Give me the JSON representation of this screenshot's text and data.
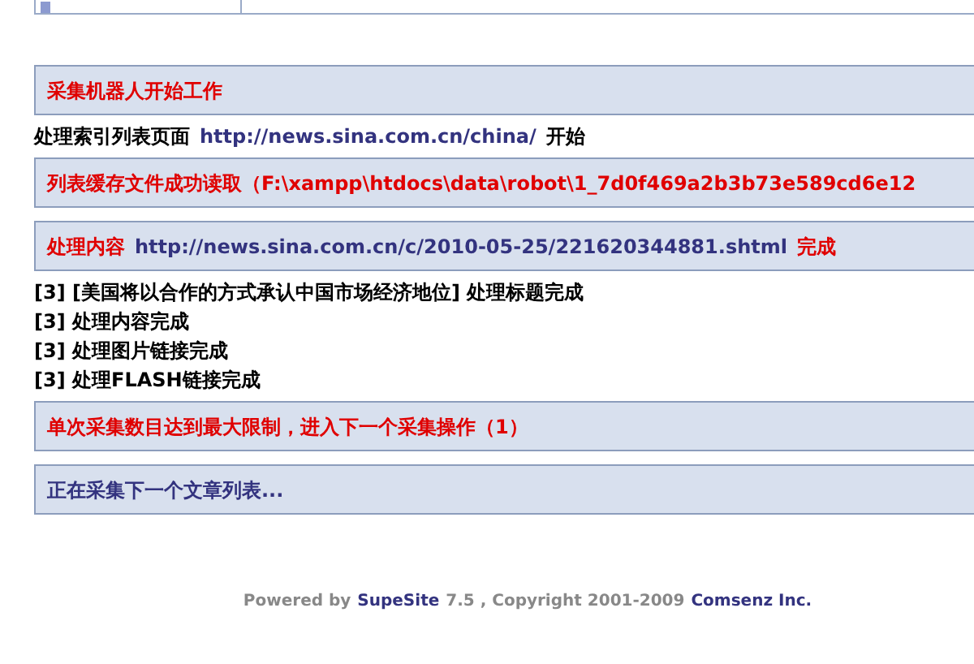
{
  "log": [
    {
      "kind": "box",
      "segments": [
        {
          "kind": "alert",
          "text": "采集机器人开始工作"
        }
      ]
    },
    {
      "kind": "line",
      "segments": [
        {
          "kind": "plain",
          "text": "处理索引列表页面"
        },
        {
          "kind": "link",
          "text": "http://news.sina.com.cn/china/"
        },
        {
          "kind": "plain",
          "text": "开始"
        }
      ]
    },
    {
      "kind": "box",
      "segments": [
        {
          "kind": "alert",
          "text": "列表缓存文件成功读取（F:\\xampp\\htdocs\\data\\robot\\1_7d0f469a2b3b73e589cd6e12"
        }
      ]
    },
    {
      "kind": "box",
      "segments": [
        {
          "kind": "alert",
          "text": "处理内容"
        },
        {
          "kind": "link",
          "text": "http://news.sina.com.cn/c/2010-05-25/221620344881.shtml"
        },
        {
          "kind": "alert",
          "text": "完成"
        }
      ]
    },
    {
      "kind": "line",
      "segments": [
        {
          "kind": "plain",
          "text": "[3] [美国将以合作的方式承认中国市场经济地位] 处理标题完成"
        }
      ]
    },
    {
      "kind": "line",
      "segments": [
        {
          "kind": "plain",
          "text": "[3] 处理内容完成"
        }
      ]
    },
    {
      "kind": "line",
      "segments": [
        {
          "kind": "plain",
          "text": "[3] 处理图片链接完成"
        }
      ]
    },
    {
      "kind": "line",
      "segments": [
        {
          "kind": "plain",
          "text": "[3] 处理FLASH链接完成"
        }
      ]
    },
    {
      "kind": "box",
      "segments": [
        {
          "kind": "alert",
          "text": "单次采集数目达到最大限制，进入下一个采集操作（1）"
        }
      ]
    },
    {
      "kind": "box",
      "segments": [
        {
          "kind": "status",
          "text": "正在采集下一个文章列表..."
        }
      ]
    }
  ],
  "footer": [
    {
      "kind": "plain",
      "text": "Powered by"
    },
    {
      "kind": "link",
      "text": "SupeSite"
    },
    {
      "kind": "plain",
      "text": "7.5 , Copyright 2001-2009"
    },
    {
      "kind": "link",
      "text": "Comsenz Inc."
    }
  ]
}
